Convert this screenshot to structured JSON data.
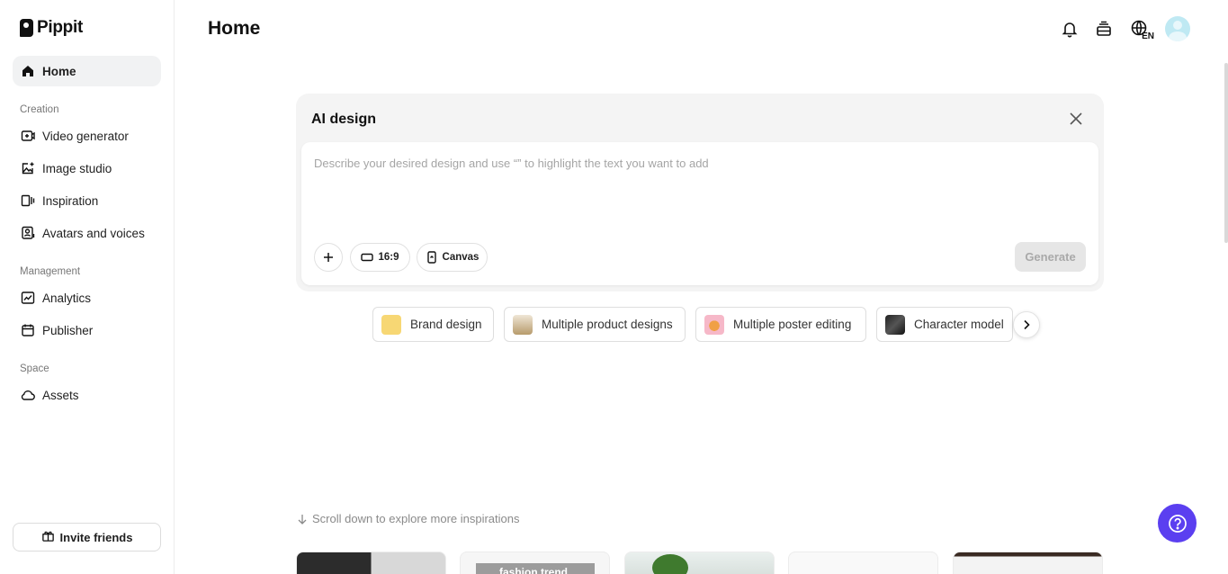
{
  "app": {
    "name": "Pippit"
  },
  "header": {
    "title": "Home",
    "lang_badge": "EN"
  },
  "sidebar": {
    "home": "Home",
    "sections": {
      "creation": "Creation",
      "management": "Management",
      "space": "Space"
    },
    "items": {
      "video_generator": "Video generator",
      "image_studio": "Image studio",
      "inspiration": "Inspiration",
      "avatars_voices": "Avatars and voices",
      "analytics": "Analytics",
      "publisher": "Publisher",
      "assets": "Assets"
    },
    "invite": "Invite friends"
  },
  "panel": {
    "title": "AI design",
    "placeholder": "Describe your desired design and use “” to highlight the text you want to add",
    "ratio": "16:9",
    "canvas": "Canvas",
    "generate": "Generate"
  },
  "chips": {
    "brand": "Brand design",
    "multi_product": "Multiple product designs",
    "poster": "Multiple poster editing",
    "character": "Character model"
  },
  "scroll_hint": "Scroll down to explore more inspirations",
  "cards": {
    "card2_label": "fashion trend"
  },
  "colors": {
    "accent": "#5b3ff0",
    "active_nav": "#f1f2f3",
    "panel_bg": "#f4f4f4",
    "generate_disabled": "#e6e6e6"
  }
}
